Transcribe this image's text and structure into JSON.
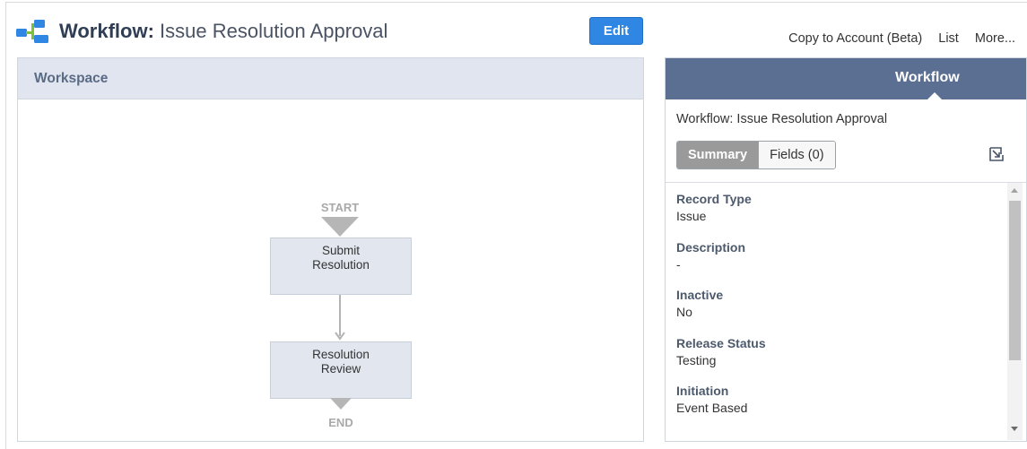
{
  "header": {
    "title_prefix": "Workflow:",
    "title_name": "Issue Resolution Approval",
    "edit_label": "Edit",
    "links": [
      "Copy to Account (Beta)",
      "List",
      "More..."
    ]
  },
  "workspace": {
    "title": "Workspace",
    "start_label": "START",
    "end_label": "END",
    "states": [
      {
        "name": "Submit\nResolution"
      },
      {
        "name": "Resolution\nReview"
      }
    ]
  },
  "side_panel": {
    "tab": "Workflow",
    "subtitle": "Workflow: Issue Resolution Approval",
    "segments": [
      "Summary",
      "Fields (0)"
    ],
    "fields": [
      {
        "label": "Record Type",
        "value": "Issue"
      },
      {
        "label": "Description",
        "value": "-"
      },
      {
        "label": "Inactive",
        "value": "No"
      },
      {
        "label": "Release Status",
        "value": "Testing"
      },
      {
        "label": "Initiation",
        "value": "Event Based"
      }
    ]
  },
  "colors": {
    "edit_button": "#2f86e3",
    "side_header": "#5b6f93",
    "workspace_header": "#e0e5ef",
    "state_fill": "#e2e7ef"
  }
}
